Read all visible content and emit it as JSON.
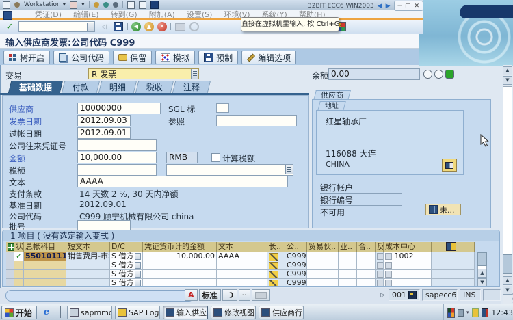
{
  "chrome": {
    "workstation_label": "Workstation",
    "vm_title": "32BIT ECC6 WIN2003",
    "tooltip": "直接在虚拟机里输入, 按 Ctrl+G.",
    "menu_items": [
      "凭证(D)",
      "编辑(E)",
      "转到(G)",
      "附加(A)",
      "设置(S)",
      "环境(V)",
      "系统(Y)",
      "帮助(H)"
    ]
  },
  "toolbar": {
    "command_value": ""
  },
  "header": {
    "title": "输入供应商发票:公司代码 C999",
    "buttons": [
      "树开启",
      "公司代码",
      "保留",
      "模拟",
      "预制",
      "编辑选项"
    ]
  },
  "transaction": {
    "label": "交易",
    "value": "R 发票",
    "balance_label": "余额",
    "balance": "0.00"
  },
  "tabs": {
    "active": "基础数据",
    "labels": [
      "基础数据",
      "付款",
      "明细",
      "税收",
      "注释"
    ]
  },
  "form": {
    "vendor_label": "供应商",
    "vendor": "10000000",
    "sgl_label": "SGL 标",
    "sgl": "",
    "invoice_date_label": "发票日期",
    "invoice_date": "2012.09.03",
    "reference_label": "参照",
    "reference": "",
    "posting_date_label": "过帐日期",
    "posting_date": "2012.09.01",
    "cross_cc_label": "公司往来凭证号",
    "cross_cc": "",
    "amount_label": "金额",
    "amount": "10,000.00",
    "currency": "RMB",
    "calc_tax_label": "计算税额",
    "tax_label": "税额",
    "tax": "",
    "tax_code": "",
    "text_label": "文本",
    "text": "AAAA",
    "payment_terms_label": "支付条款",
    "payment_terms": "14 天数 2 %, 30 天内净额",
    "baseline_date_label": "基准日期",
    "baseline_date": "2012.09.01",
    "company_code_label": "公司代码",
    "company_code": "C999 顾宁机械有限公司 china",
    "lot_label": "批号",
    "lot": ""
  },
  "vendor_panel": {
    "title": "供应商",
    "address_label": "地址",
    "name": "红星轴承厂",
    "city": "116088 大连",
    "country": "CHINA",
    "bank_account_label": "银行帐户",
    "bank_number_label": "银行编号",
    "unavailable": "不可用",
    "open_items_button": "未..."
  },
  "items": {
    "summary": "1 项目 ( 没有选定输入变式 )",
    "columns": [
      "状..",
      "总帐科目",
      "短文本",
      "D/C",
      "凭证货币计的金额",
      "文本",
      "长..",
      "公..",
      "贸易伙..",
      "业..",
      "合..",
      "反..",
      "成本中心"
    ],
    "rows": [
      {
        "status": "✓",
        "gl_account": "55010111",
        "short_text": "销售费用-市场",
        "dc": "S 借方",
        "amount": "10,000.00",
        "text": "AAAA",
        "company": "C999",
        "cost_center": "1002"
      },
      {
        "status": "",
        "gl_account": "",
        "short_text": "",
        "dc": "S 借方",
        "amount": "",
        "text": "",
        "company": "C999",
        "cost_center": ""
      },
      {
        "status": "",
        "gl_account": "",
        "short_text": "",
        "dc": "S 借方",
        "amount": "",
        "text": "",
        "company": "C999",
        "cost_center": ""
      },
      {
        "status": "",
        "gl_account": "",
        "short_text": "",
        "dc": "S 借方",
        "amount": "",
        "text": "",
        "company": "C999",
        "cost_center": ""
      }
    ]
  },
  "statusbar": {
    "message": "",
    "buttons": [
      "A",
      "标准"
    ],
    "session": "001",
    "system": "sapecc6",
    "mode": "INS"
  },
  "taskbar": {
    "start": "开始",
    "tasks": [
      "sapmmc - ...",
      "SAP Logon...",
      "输入供应...",
      "修改视图 ...",
      "供应商行..."
    ],
    "active_task": "输入供应...",
    "clock": "12:43"
  }
}
